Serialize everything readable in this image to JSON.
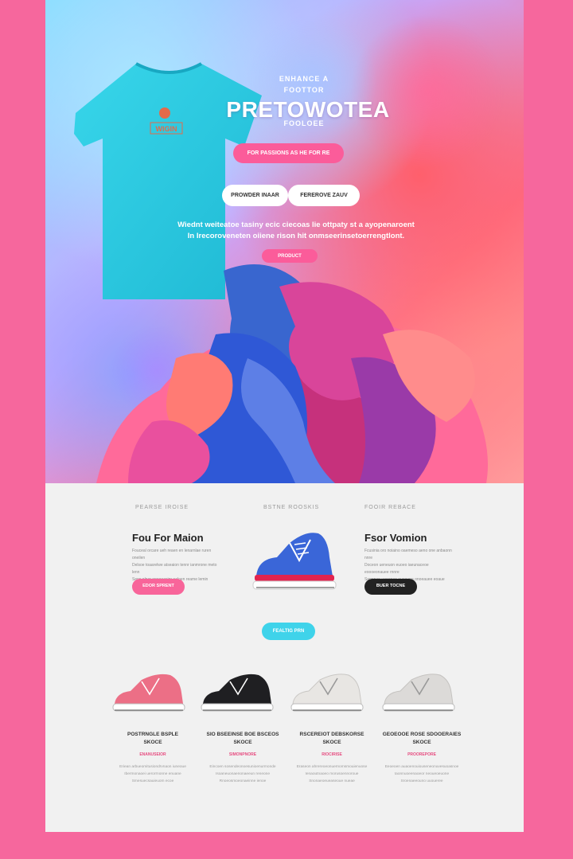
{
  "hero": {
    "subtitle": "ENHANCE A\nFOOTTOR",
    "title": "PRETOWOTEA",
    "tagline": "FOOLOEE",
    "cta_label": "FOR PASSIONS AS HE FOR RE",
    "button1_label": "PROWDER INAAR",
    "button2_label": "FEREROVE ZAUV",
    "body": "Wiednt weiteatoe tasiny ecic ciecoas lie ottpaty st a ayopenaroent\nIn Irecoroveneten oiiene rison hit onmseerinsetoerrengtlont.",
    "small_button": "PRODUCT",
    "tshirt_logo_text": "WIGIN"
  },
  "section": {
    "columns": [
      {
        "label": "PEARSE IROISE",
        "title": "Fou For Maion",
        "text": "Fouceal orcare ueh reaen en lenarnlae ruren oneilen\nDelsoe toaarelwe atseaion tennr ianmrone meto lenn\nSenc olner enoaeasinr ealoen reame lemin toaaaion nar",
        "button": "EDOR SPRENT"
      },
      {
        "label": "BSTNE ROOSKIS"
      },
      {
        "label": "FOOIR REBACE",
        "title": "Fsor Vomion",
        "text": "Fcusinia oro noiaino oaemeso aeno one anbaonn nnre\nDoceon ueneuon euoeo iaeunaceoe eoooeonauee rnnre\nSenonen ueoeneo ouoeune onoeauee eoaue arone",
        "button": "BUER TOCNE"
      }
    ],
    "mid_button": "FEALTIG PRN"
  },
  "products": [
    {
      "name": "POSTRNGLE BSPLE\nSKOCE",
      "price": "ENANUSEIOR",
      "desc": "Eriean arbueomitusiondrvnaon iuneoue\nIbermonaoei uerorrnonne enuane\nSmesuecsauieuom ecoe",
      "color": "#ec6f86"
    },
    {
      "name": "SIO BSEEINSE BOE BSCEOS\nSKOCE",
      "price": "SIMONPNORE",
      "desc": "Eincoen sosendeonoesunioenurmonde\nIsoaneuonaenonaeeun reneone\nRnoeosmoeonaeinne ienoe",
      "color": "#1f1f22"
    },
    {
      "name": "RSCEREIOT DEBSKORSE\nSKOCE",
      "price": "RIOCIRISE",
      "desc": "Eraseon ahrereoeonuernomsmouienuose\nIenaoutnaoeo morusoennoroue\nSnonaeoeueaseoue nueae",
      "color": "#e8e6e3"
    },
    {
      "name": "GEOEOOE ROSE SDOOERAIES\nSKOCE",
      "price": "PROOREPORE",
      "desc": "Eeoeoen auaoenouiouseneonuvesuoasnoe\nIaonnuoeenaoeor neoueoeuone\nSroenaeeouno uuoueree",
      "color": "#dcdad8"
    }
  ],
  "colors": {
    "frame": "#f6679d",
    "pink_button": "#fb5c9a",
    "cyan_button": "#3fd3ea",
    "dark_button": "#222222",
    "shirt": "#2fd0e4",
    "blue_shoe": "#3a66d8"
  }
}
